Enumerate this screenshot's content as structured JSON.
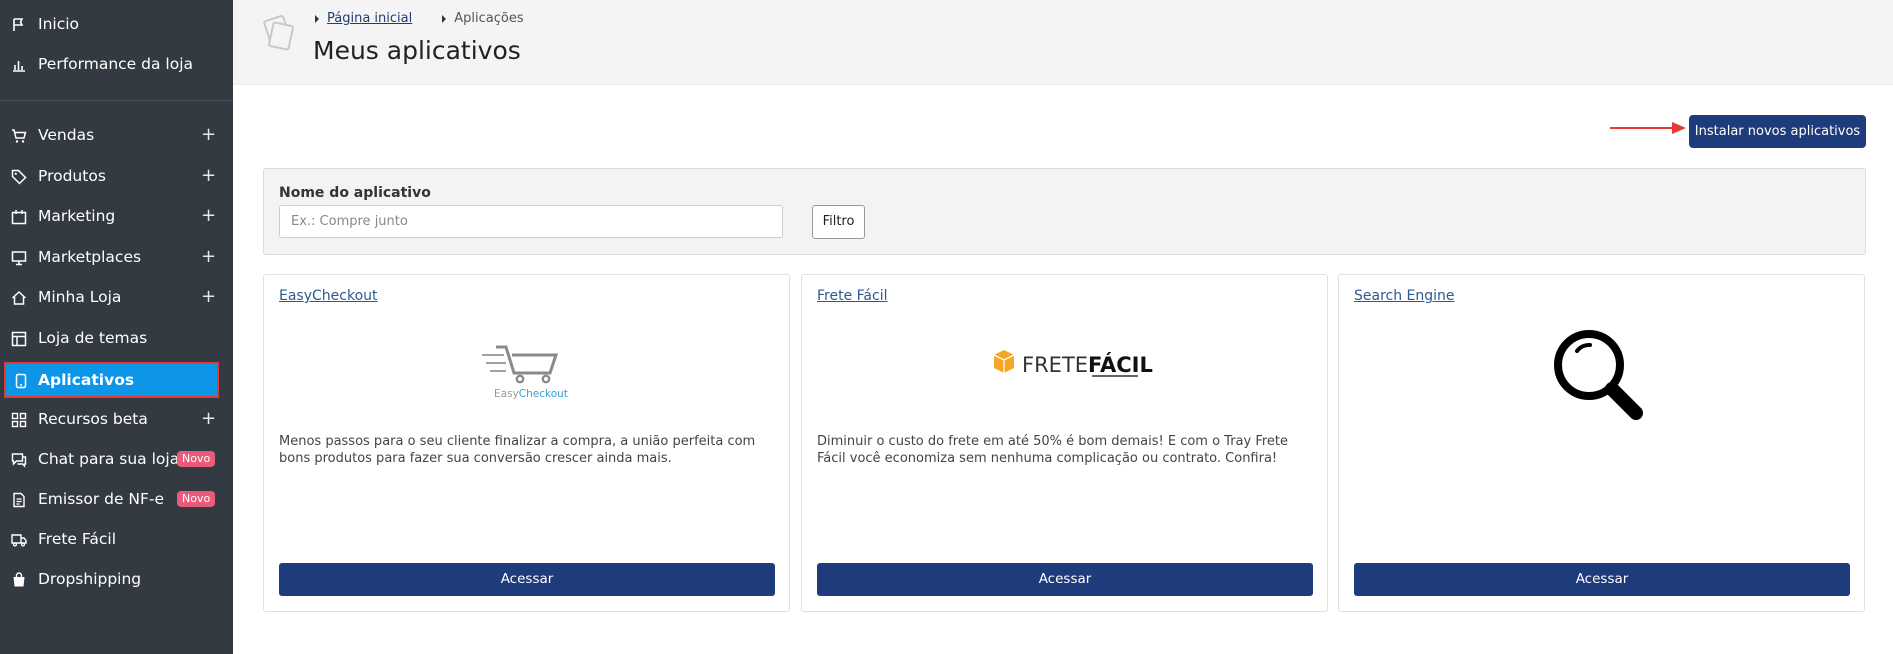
{
  "sidebar": {
    "items": [
      {
        "label": "Inicio",
        "icon": "flag-icon"
      },
      {
        "label": "Performance da loja",
        "icon": "bar-chart-icon"
      },
      {
        "label": "Vendas",
        "icon": "cart-icon",
        "expand": "+"
      },
      {
        "label": "Produtos",
        "icon": "tag-icon",
        "expand": "+"
      },
      {
        "label": "Marketing",
        "icon": "calendar-icon",
        "expand": "+"
      },
      {
        "label": "Marketplaces",
        "icon": "monitor-icon",
        "expand": "+"
      },
      {
        "label": "Minha Loja",
        "icon": "home-icon",
        "expand": "+"
      },
      {
        "label": "Loja de temas",
        "icon": "layout-icon"
      },
      {
        "label": "Aplicativos",
        "icon": "phone-icon"
      },
      {
        "label": "Recursos beta",
        "icon": "grid-icon",
        "expand": "+"
      },
      {
        "label": "Chat para sua loja",
        "icon": "chat-icon",
        "badge": "Novo"
      },
      {
        "label": "Emissor de NF-e",
        "icon": "document-icon",
        "badge": "Novo"
      },
      {
        "label": "Frete Fácil",
        "icon": "truck-icon"
      },
      {
        "label": "Dropshipping",
        "icon": "bag-icon"
      }
    ]
  },
  "header": {
    "breadcrumb_home": "Página inicial",
    "breadcrumb_current": "Aplicações",
    "title": "Meus aplicativos"
  },
  "install_button": "Instalar novos aplicativos",
  "filter": {
    "label": "Nome do aplicativo",
    "placeholder": "Ex.: Compre junto",
    "button": "Filtro"
  },
  "cards": [
    {
      "title": "EasyCheckout",
      "logo_text_a": "Easy",
      "logo_text_b": "Checkout",
      "description": "Menos passos para o seu cliente finalizar a compra, a união perfeita com bons produtos para fazer sua conversão crescer ainda mais.",
      "button": "Acessar"
    },
    {
      "title": "Frete Fácil",
      "logo_text_a": "FRETE",
      "logo_text_b": "FÁCIL",
      "description": "Diminuir o custo do frete em até 50% é bom demais! E com o Tray Frete Fácil você economiza sem nenhuma complicação ou contrato. Confira!",
      "button": "Acessar"
    },
    {
      "title": "Search Engine",
      "description": "",
      "button": "Acessar"
    }
  ],
  "colors": {
    "sidebar_bg": "#343a42",
    "active_bg": "#0d95e8",
    "primary_button": "#1e3b7b",
    "badge": "#e85b7b",
    "highlight_border": "#e53935"
  }
}
